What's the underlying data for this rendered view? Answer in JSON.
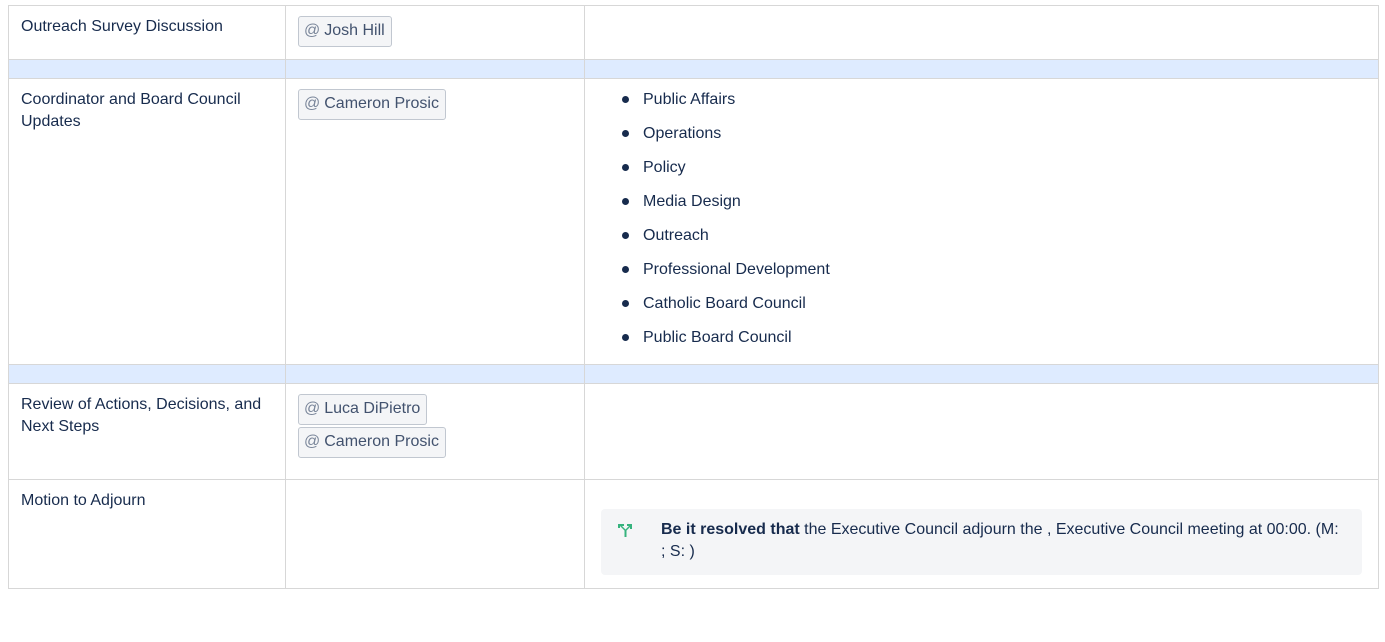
{
  "rows": [
    {
      "item": "Outreach Survey Discussion",
      "owners": [
        "Josh Hill"
      ]
    },
    {
      "item": "Coordinator and Board Council Updates",
      "owners": [
        "Cameron Prosic"
      ],
      "notes": [
        "Public Affairs",
        "Operations",
        "Policy",
        "Media Design",
        "Outreach",
        "Professional Development",
        "Catholic Board Council",
        "Public Board Council"
      ]
    },
    {
      "item": "Review of Actions, Decisions, and Next Steps",
      "owners": [
        "Luca DiPietro",
        "Cameron Prosic"
      ]
    },
    {
      "item": "Motion to Adjourn",
      "decision": {
        "bold_prefix": "Be it resolved that",
        "text": " the Executive Council adjourn the , Executive Council meeting at 00:00. (M: ; S: )"
      }
    }
  ],
  "mention_prefix": "@",
  "colors": {
    "spacer_row": "#deebff",
    "border": "#d7d7d7",
    "decision_bg": "#f4f5f7",
    "decision_icon": "#36b37e"
  },
  "icons": {
    "decision": "decision-icon",
    "bullet": "bullet-dot"
  }
}
